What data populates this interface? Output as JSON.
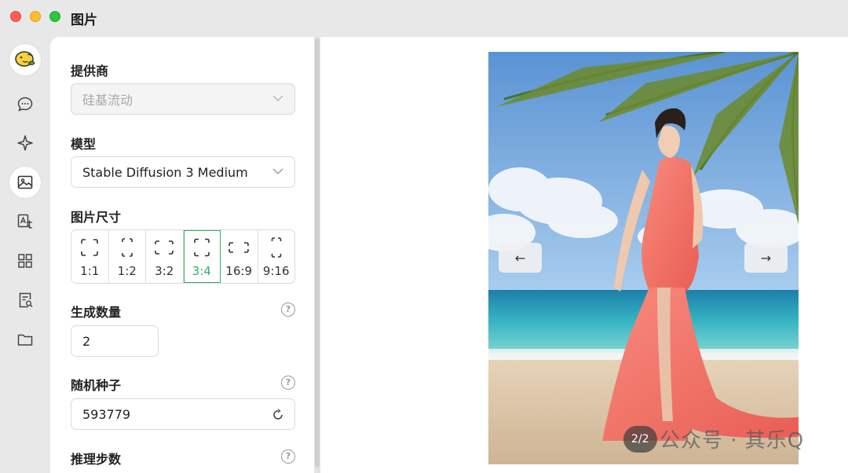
{
  "window": {
    "title": "图片"
  },
  "sidebar": {
    "items": [
      {
        "name": "chat",
        "icon": "chat-bubble-icon"
      },
      {
        "name": "agents",
        "icon": "sparkle-icon"
      },
      {
        "name": "image",
        "icon": "image-icon",
        "active": true
      },
      {
        "name": "translate",
        "icon": "translate-icon"
      },
      {
        "name": "apps",
        "icon": "grid-icon"
      },
      {
        "name": "files",
        "icon": "document-search-icon"
      },
      {
        "name": "folder",
        "icon": "folder-icon"
      }
    ]
  },
  "settings": {
    "provider_label": "提供商",
    "provider_value": "硅基流动",
    "model_label": "模型",
    "model_value": "Stable Diffusion 3 Medium",
    "size_label": "图片尺寸",
    "sizes": [
      "1:1",
      "1:2",
      "3:2",
      "3:4",
      "16:9",
      "9:16"
    ],
    "selected_size": "3:4",
    "count_label": "生成数量",
    "count_value": "2",
    "seed_label": "随机种子",
    "seed_value": "593779",
    "steps_label": "推理步数",
    "help_glyph": "?"
  },
  "viewer": {
    "prev_glyph": "←",
    "next_glyph": "→",
    "counter": "2/2"
  },
  "watermark": "公众号 · 其乐Q",
  "colors": {
    "accent": "#28b463",
    "traffic_red": "#fe5f57",
    "traffic_yellow": "#febc2e",
    "traffic_green": "#28c840"
  }
}
